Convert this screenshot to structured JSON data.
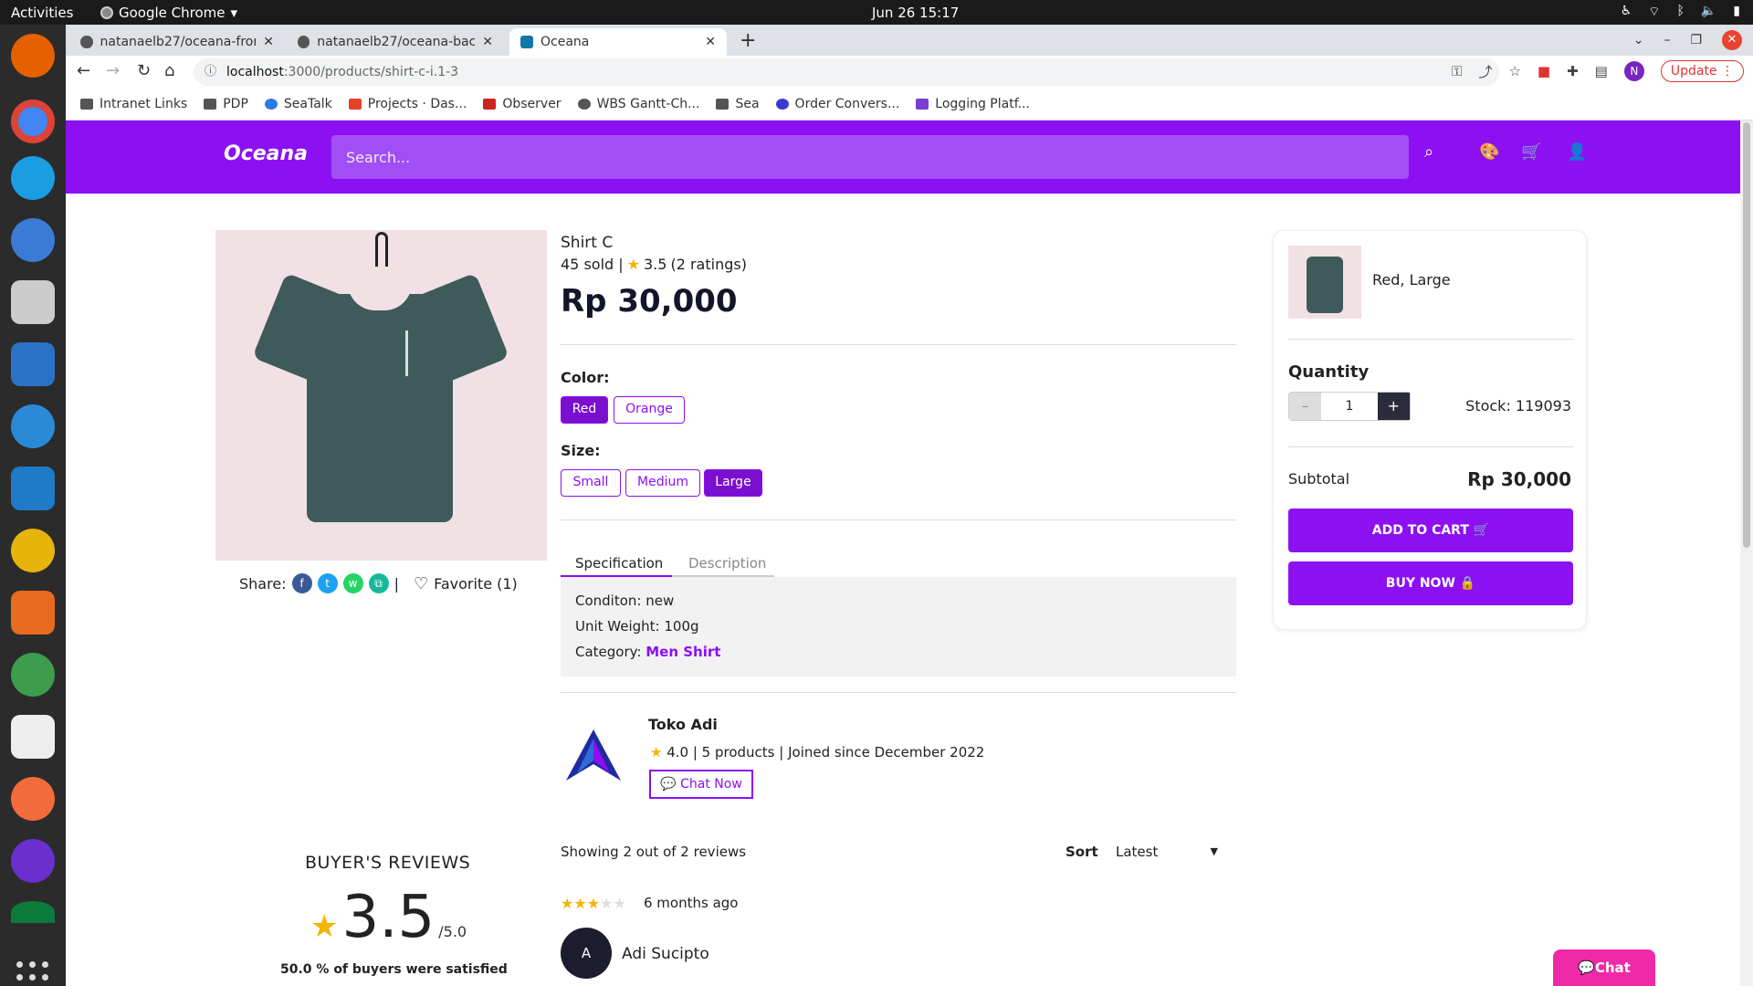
{
  "system": {
    "activities": "Activities",
    "app_name": "Google Chrome",
    "clock": "Jun 26  15:17"
  },
  "browser": {
    "tabs": [
      {
        "title": "natanaelb27/oceana-fron"
      },
      {
        "title": "natanaelb27/oceana-back"
      },
      {
        "title": "Oceana"
      }
    ],
    "url_host": "localhost",
    "url_path": ":3000/products/shirt-c-i.1-3",
    "update_label": "Update",
    "profile_initial": "N",
    "bookmarks": [
      "Intranet Links",
      "PDP",
      "SeaTalk",
      "Projects · Das...",
      "Observer",
      "WBS Gantt-Ch...",
      "Sea",
      "Order Convers...",
      "Logging Platf..."
    ]
  },
  "site": {
    "logo": "Oceana",
    "search_placeholder": "Search..."
  },
  "product": {
    "name": "Shirt C",
    "sold": "45 sold |",
    "rating": "3.5",
    "ratings_count": "(2 ratings)",
    "price": "Rp 30,000",
    "color_label": "Color:",
    "colors": [
      "Red",
      "Orange"
    ],
    "selected_color": "Red",
    "size_label": "Size:",
    "sizes": [
      "Small",
      "Medium",
      "Large"
    ],
    "selected_size": "Large",
    "share_label": "Share:",
    "favorite_label": "Favorite (1)",
    "divider": "|"
  },
  "tabs": {
    "specification": "Specification",
    "description": "Description"
  },
  "spec": {
    "condition": "Conditon: new",
    "weight": "Unit Weight: 100g",
    "category_label": "Category: ",
    "category_value": "Men Shirt"
  },
  "store": {
    "name": "Toko Adi",
    "meta": "4.0 | 5 products | Joined since December 2022",
    "chat_label": "Chat Now"
  },
  "reviews": {
    "title": "BUYER'S REVIEWS",
    "score": "3.5",
    "out_of": "/5.0",
    "satisfied": "50.0 % of buyers were satisfied",
    "showing": "Showing 2 out of 2 reviews",
    "sort_label": "Sort",
    "sort_value": "Latest",
    "first": {
      "stars": 3,
      "ago": "6 months ago",
      "initial": "A",
      "name": "Adi Sucipto"
    }
  },
  "cart": {
    "variant": "Red, Large",
    "quantity_label": "Quantity",
    "quantity": "1",
    "stock": "Stock: 119093",
    "subtotal_label": "Subtotal",
    "subtotal": "Rp 30,000",
    "add_to_cart": "ADD TO CART",
    "buy_now": "BUY NOW"
  },
  "float_chat": "Chat",
  "colors": {
    "brand": "#8c10f2",
    "star": "#f5b400",
    "chat": "#ee2aa8"
  }
}
